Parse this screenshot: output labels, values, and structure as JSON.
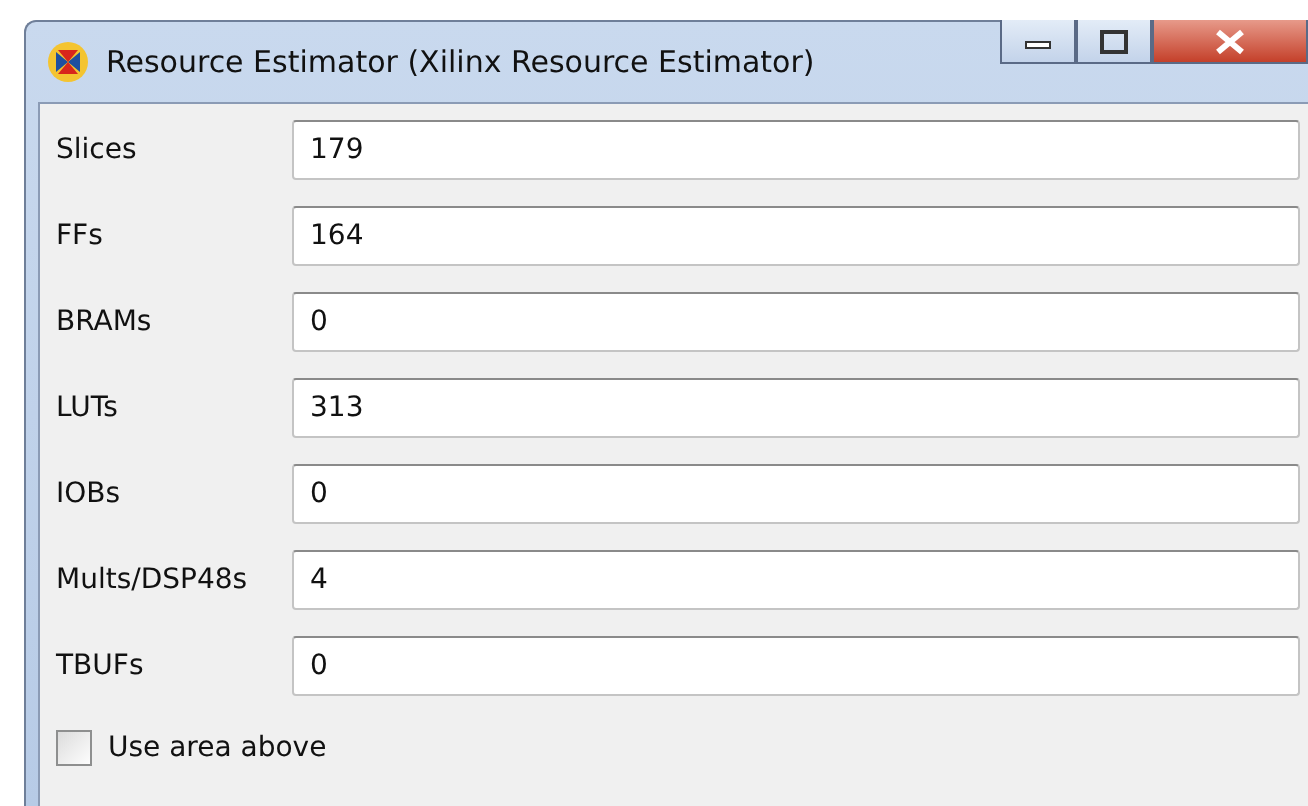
{
  "window": {
    "title": "Resource Estimator (Xilinx Resource Estimator)"
  },
  "fields": [
    {
      "label": "Slices",
      "value": "179"
    },
    {
      "label": "FFs",
      "value": "164"
    },
    {
      "label": "BRAMs",
      "value": "0"
    },
    {
      "label": "LUTs",
      "value": "313"
    },
    {
      "label": "IOBs",
      "value": "0"
    },
    {
      "label": "Mults/DSP48s",
      "value": "4"
    },
    {
      "label": "TBUFs",
      "value": "0"
    }
  ],
  "option": {
    "label": "Use area above",
    "checked": false
  }
}
